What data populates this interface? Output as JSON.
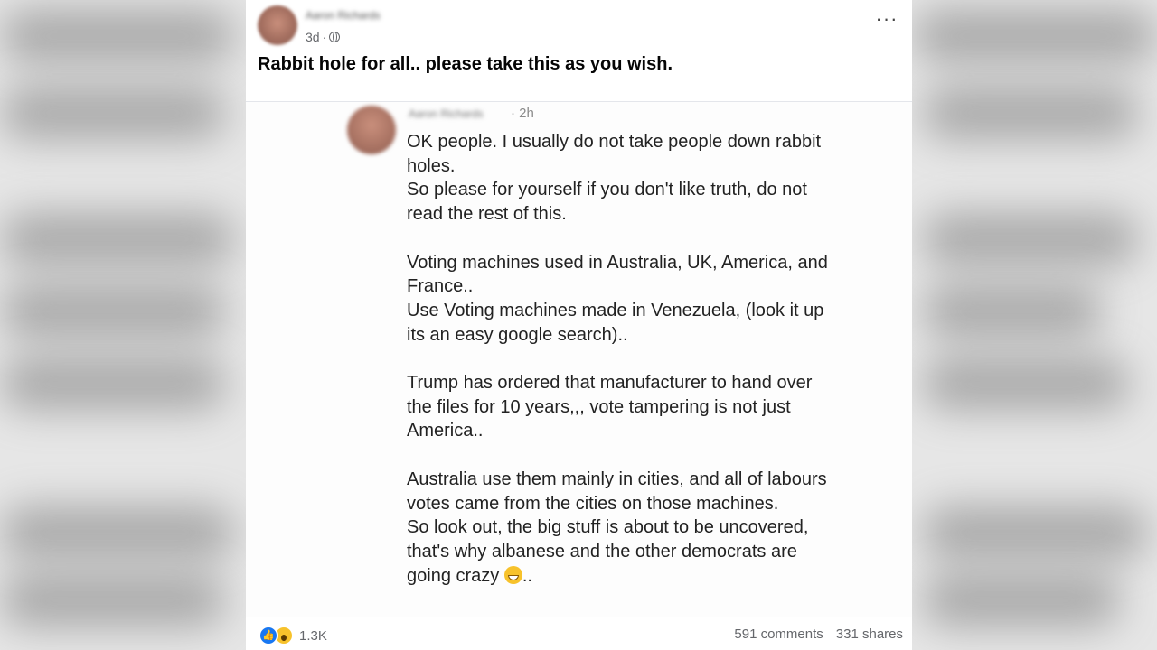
{
  "post": {
    "author": "Aaron Richards",
    "time": "3d",
    "separator": "·",
    "more_label": "···",
    "text": "Rabbit hole for all.. please take this as you wish."
  },
  "comment": {
    "author": "Aaron Richards",
    "time": "· 2h",
    "paragraphs": [
      "OK people. I usually do not take people down rabbit holes.\nSo please for yourself if you don't like truth, do not read the rest of this.",
      "Voting machines used in Australia, UK, America, and France..\nUse Voting machines made in Venezuela, (look it up its an easy google search)..",
      "Trump has ordered that manufacturer to hand over the files for 10 years,,, vote tampering is not just America..",
      "Australia use them mainly in cities, and all of labours votes came from the cities on those machines.\nSo look out, the big stuff is about to be uncovered, that's why albanese and the other democrats are going crazy"
    ],
    "ending": ".."
  },
  "footer": {
    "reaction_count": "1.3K",
    "comments": "591 comments",
    "shares": "331 shares"
  },
  "icons": {
    "like": "like-icon",
    "wow": "wow-icon",
    "globe": "globe-icon",
    "emoji": "grinning-emoji-icon"
  },
  "colors": {
    "like_blue": "#1877f2",
    "wow_yellow": "#f7c22b",
    "meta_gray": "#65676b"
  }
}
